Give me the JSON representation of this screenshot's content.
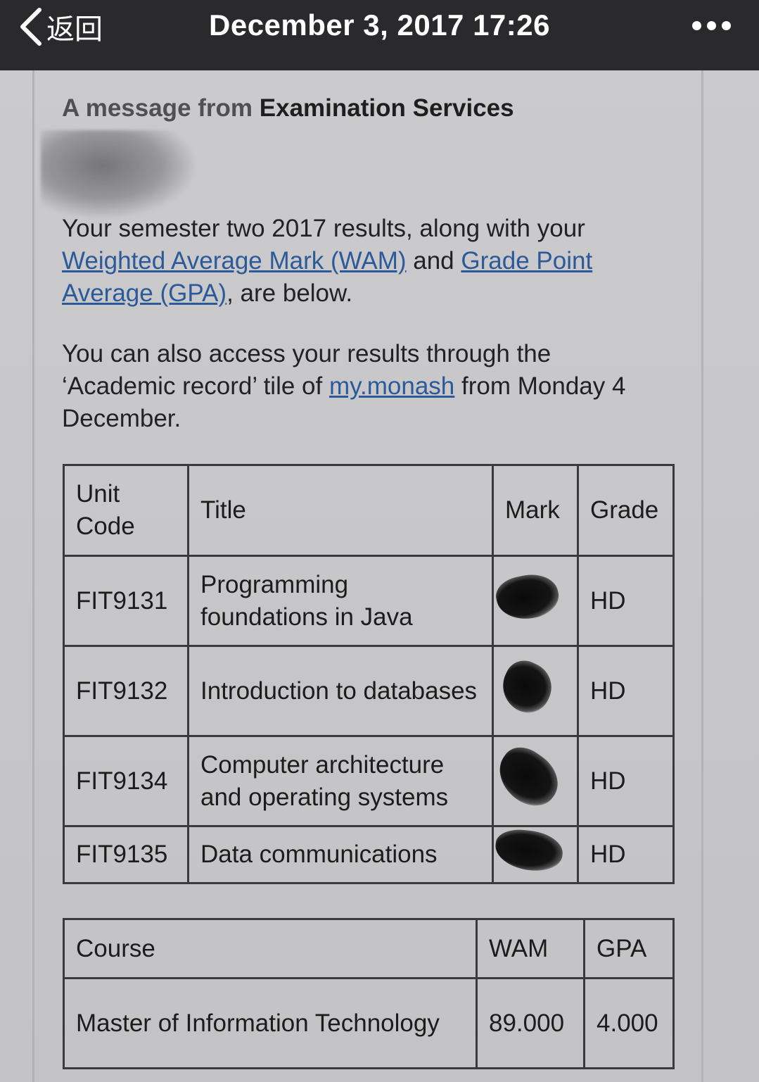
{
  "nav": {
    "back_label": "返回",
    "title": "December 3, 2017 17:26"
  },
  "email": {
    "heading_prefix": "A message from ",
    "heading_sender": "Examination Services",
    "para1_start": "Your semester two 2017 results, along with your ",
    "link_wam": "Weighted Average Mark (WAM)",
    "para1_and": " and ",
    "link_gpa": "Grade Point Average (GPA)",
    "para1_end": ", are below.",
    "para2_start": "You can also access your results through the ‘Academic record’ tile of ",
    "link_mymonash": "my.monash",
    "para2_end": " from Monday 4 December."
  },
  "results": {
    "headers": [
      "Unit Code",
      "Title",
      "Mark",
      "Grade"
    ],
    "rows": [
      {
        "code": "FIT9131",
        "title": "Programming foundations in Java",
        "grade": "HD"
      },
      {
        "code": "FIT9132",
        "title": "Introduction to databases",
        "grade": "HD"
      },
      {
        "code": "FIT9134",
        "title": "Computer architecture and operating systems",
        "grade": "HD"
      },
      {
        "code": "FIT9135",
        "title": "Data communications",
        "grade": "HD"
      }
    ]
  },
  "summary": {
    "headers": [
      "Course",
      "WAM",
      "GPA"
    ],
    "course": "Master of Information Technology",
    "wam": "89.000",
    "gpa": "4.000"
  }
}
